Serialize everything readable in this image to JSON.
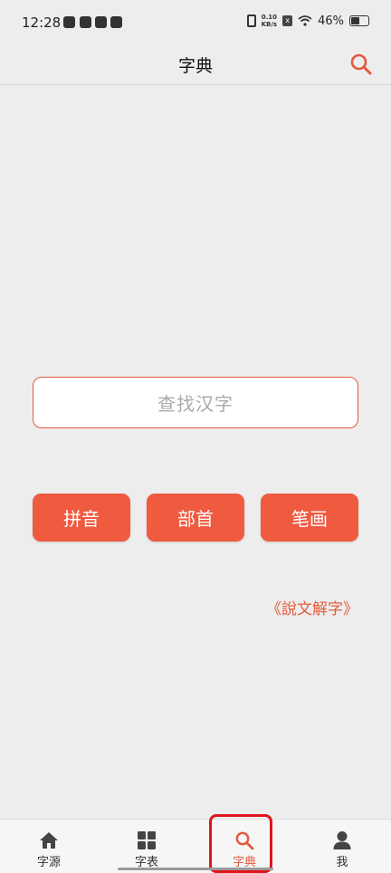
{
  "status_bar": {
    "time": "12:28",
    "net_speed_value": "0.10",
    "net_speed_unit": "KB/s",
    "battery_text": "46%",
    "battery_level": 0.46
  },
  "header": {
    "title": "字典",
    "search_icon": "search-icon"
  },
  "search": {
    "placeholder": "查找汉字"
  },
  "buttons": {
    "pinyin": "拼音",
    "bushou": "部首",
    "bihua": "笔画"
  },
  "link": {
    "shuowen": "《說文解字》"
  },
  "bottom_nav": {
    "items": [
      {
        "label": "字源",
        "icon": "home-icon"
      },
      {
        "label": "字表",
        "icon": "grid-icon"
      },
      {
        "label": "字典",
        "icon": "search-icon"
      },
      {
        "label": "我",
        "icon": "user-icon"
      }
    ],
    "active_index": 2
  },
  "colors": {
    "accent": "#f05a3f",
    "accent_text": "#e35a3d",
    "highlight_box": "#e0141c",
    "background": "#ededed"
  }
}
